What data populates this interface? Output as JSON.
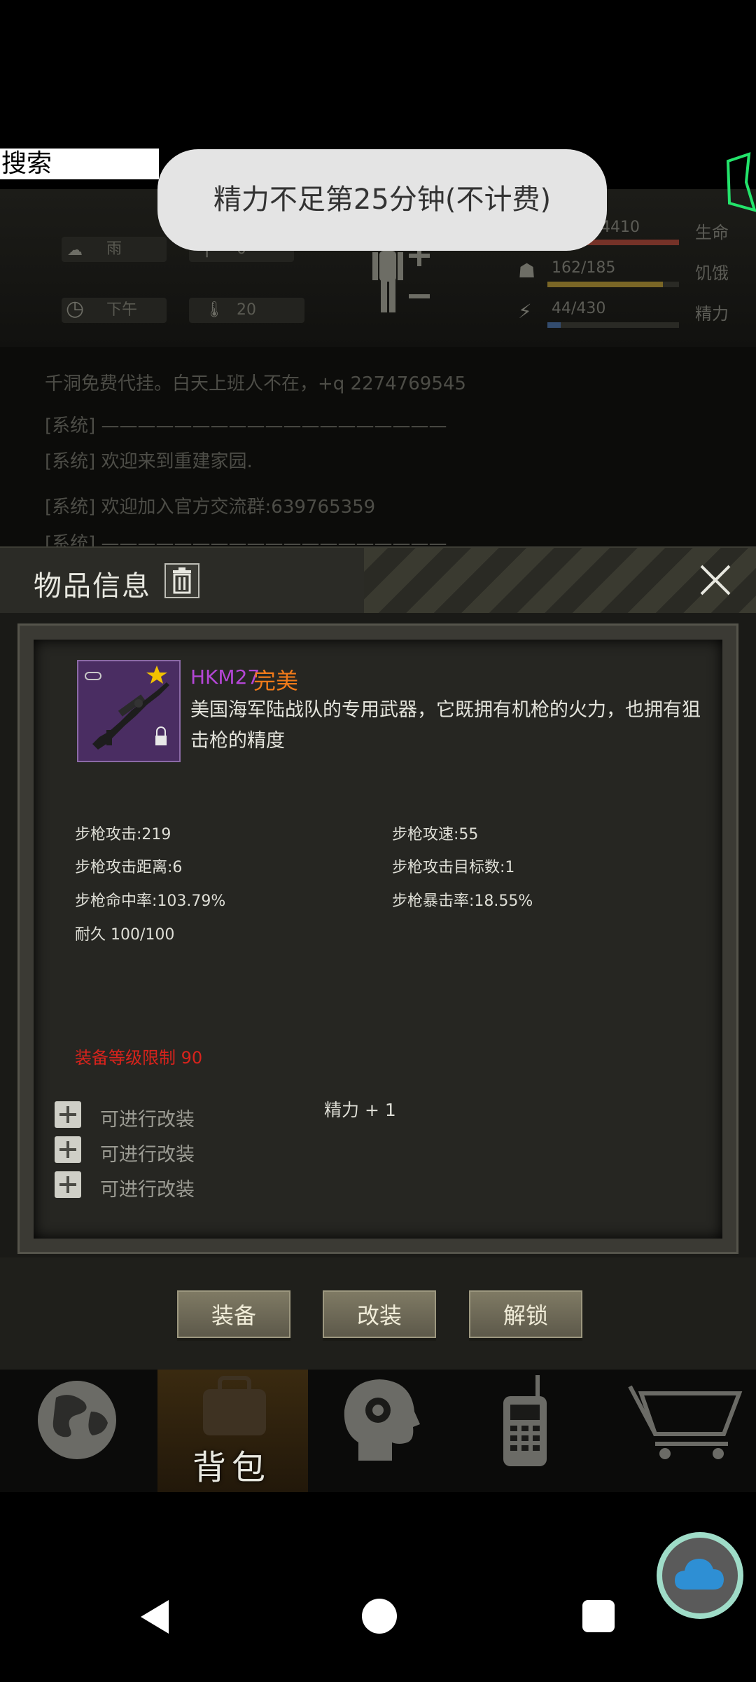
{
  "search": {
    "label": "搜索"
  },
  "toast": {
    "text": "精力不足第25分钟(不计费)"
  },
  "hud": {
    "weather": "雨",
    "weather_value": "0",
    "time": "下午",
    "temperature": "20",
    "stats": [
      {
        "label": "生命",
        "value": "4410",
        "fill": 1.0,
        "color": "#c0392b"
      },
      {
        "label": "饥饿",
        "value": "162/185",
        "fill": 0.875,
        "color": "#c9a227"
      },
      {
        "label": "精力",
        "value": "44/430",
        "fill": 0.1,
        "color": "#3b6db8"
      }
    ]
  },
  "chat": {
    "lines": [
      "千洞免费代挂。白天上班人不在，+q 2274769545",
      "[系统] ———————————————————",
      "[系统] 欢迎来到重建家园.",
      "[系统]  欢迎加入官方交流群:639765359",
      "[系统] ———————————————————"
    ]
  },
  "modal": {
    "title": "物品信息",
    "item": {
      "name": "HKM27",
      "quality": "完美",
      "description": "美国海军陆战队的专用武器，它既拥有机枪的火力，也拥有狙击枪的精度"
    },
    "stats_left": [
      "步枪攻击:219",
      "步枪攻击距离:6",
      "步枪命中率:103.79%",
      "耐久 100/100"
    ],
    "stats_right": [
      "步枪攻速:55",
      "步枪攻击目标数:1",
      "步枪暴击率:18.55%"
    ],
    "level_limit": "装备等级限制 90",
    "mods": [
      "可进行改装",
      "可进行改装",
      "可进行改装"
    ],
    "bonus": "精力 + 1",
    "buttons": {
      "equip": "装备",
      "modify": "改装",
      "unlock": "解锁"
    }
  },
  "nav": {
    "bag": "背包"
  }
}
